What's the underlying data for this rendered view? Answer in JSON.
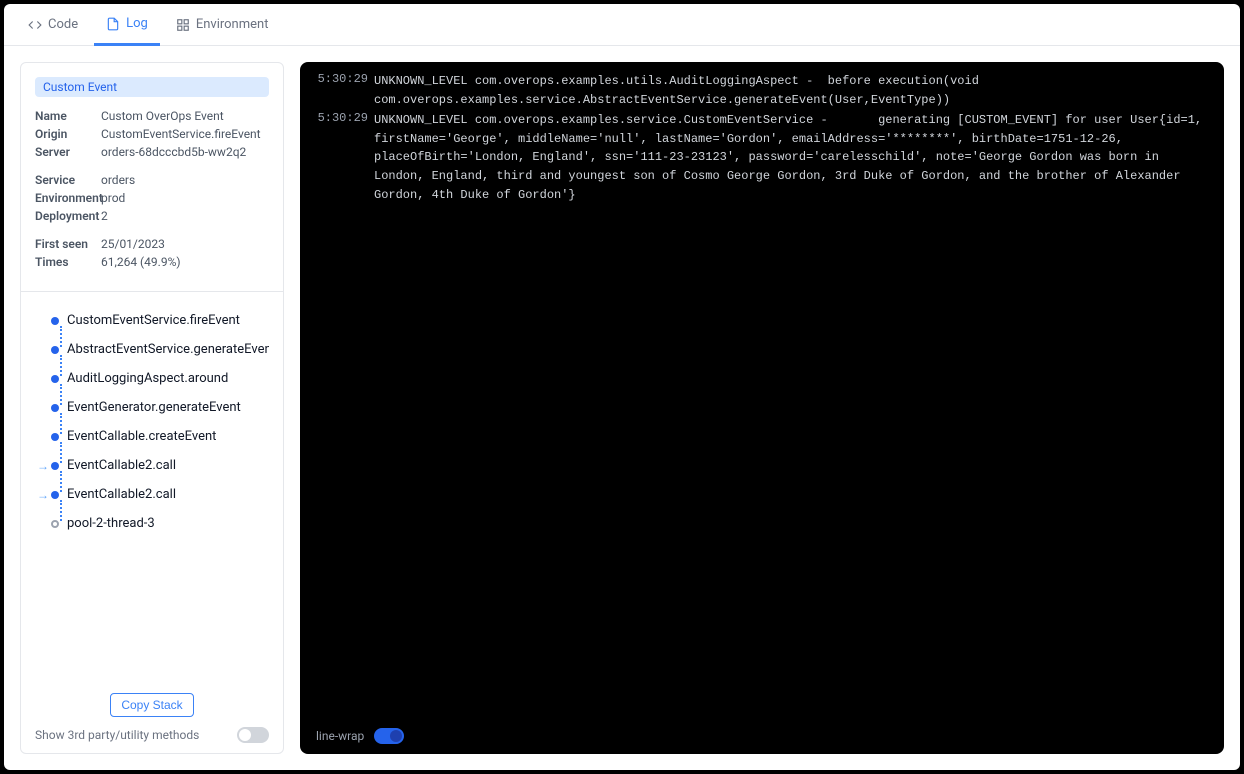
{
  "tabs": {
    "code": "Code",
    "log": "Log",
    "environment": "Environment"
  },
  "badge": "Custom Event",
  "meta1": [
    {
      "label": "Name",
      "value": "Custom OverOps Event"
    },
    {
      "label": "Origin",
      "value": "CustomEventService.fireEvent"
    },
    {
      "label": "Server",
      "value": "orders-68dcccbd5b-ww2q2"
    }
  ],
  "meta2": [
    {
      "label": "Service",
      "value": "orders"
    },
    {
      "label": "Environment",
      "value": "prod"
    },
    {
      "label": "Deployment",
      "value": "2"
    }
  ],
  "meta3": [
    {
      "label": "First seen",
      "value": "25/01/2023"
    },
    {
      "label": "Times",
      "value": "61,264 (49.9%)"
    }
  ],
  "stack": [
    {
      "type": "dot",
      "label": "CustomEventService.fireEvent"
    },
    {
      "type": "dot",
      "label": "AbstractEventService.generateEvent"
    },
    {
      "type": "dot",
      "label": "AuditLoggingAspect.around"
    },
    {
      "type": "dot",
      "label": "EventGenerator.generateEvent"
    },
    {
      "type": "dot",
      "label": "EventCallable.createEvent"
    },
    {
      "type": "arrow",
      "label": "EventCallable2.call"
    },
    {
      "type": "arrow",
      "label": "EventCallable2.call"
    },
    {
      "type": "hollow",
      "label": "pool-2-thread-3"
    }
  ],
  "copy_stack": "Copy Stack",
  "show_3rd_party": "Show 3rd party/utility methods",
  "line_wrap": "line-wrap",
  "log": [
    {
      "ts": "5:30:29",
      "body": "UNKNOWN_LEVEL com.overops.examples.utils.AuditLoggingAspect -  before execution(void com.overops.examples.service.AbstractEventService.generateEvent(User,EventType))"
    },
    {
      "ts": "5:30:29",
      "body": "UNKNOWN_LEVEL com.overops.examples.service.CustomEventService -       generating [CUSTOM_EVENT] for user User{id=1, firstName='George', middleName='null', lastName='Gordon', emailAddress='********', birthDate=1751-12-26, placeOfBirth='London, England', ssn='111-23-23123', password='carelesschild', note='George Gordon was born in London, England, third and youngest son of Cosmo George Gordon, 3rd Duke of Gordon, and the brother of Alexander Gordon, 4th Duke of Gordon'}"
    }
  ]
}
